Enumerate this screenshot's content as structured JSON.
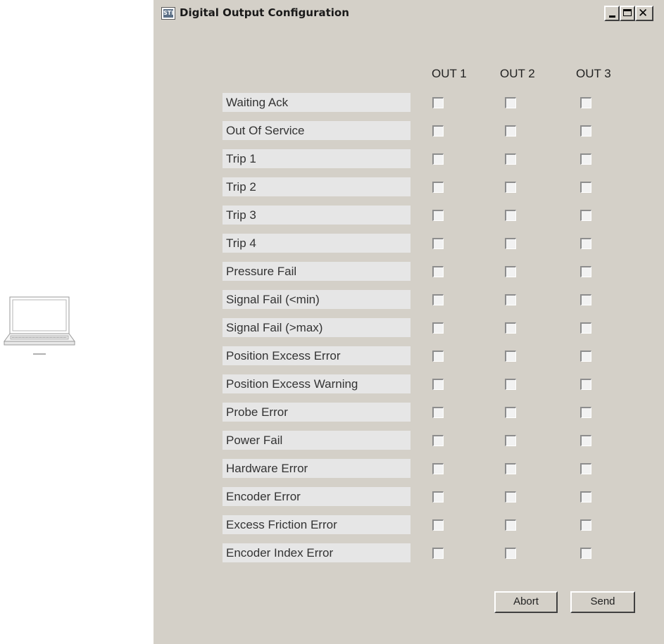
{
  "window": {
    "title": "Digital Output Configuration",
    "icon_text": "STI"
  },
  "columns": [
    "OUT 1",
    "OUT 2",
    "OUT 3"
  ],
  "rows": [
    {
      "label": "Waiting Ack",
      "checked": [
        false,
        false,
        false
      ]
    },
    {
      "label": "Out Of Service",
      "checked": [
        false,
        false,
        false
      ]
    },
    {
      "label": "Trip 1",
      "checked": [
        false,
        false,
        false
      ]
    },
    {
      "label": "Trip 2",
      "checked": [
        false,
        false,
        false
      ]
    },
    {
      "label": "Trip 3",
      "checked": [
        false,
        false,
        false
      ]
    },
    {
      "label": "Trip 4",
      "checked": [
        false,
        false,
        false
      ]
    },
    {
      "label": "Pressure Fail",
      "checked": [
        false,
        false,
        false
      ]
    },
    {
      "label": "Signal Fail (<min)",
      "checked": [
        false,
        false,
        false
      ]
    },
    {
      "label": "Signal Fail (>max)",
      "checked": [
        false,
        false,
        false
      ]
    },
    {
      "label": "Position Excess Error",
      "checked": [
        false,
        false,
        false
      ]
    },
    {
      "label": "Position Excess Warning",
      "checked": [
        false,
        false,
        false
      ]
    },
    {
      "label": "Probe Error",
      "checked": [
        false,
        false,
        false
      ]
    },
    {
      "label": "Power Fail",
      "checked": [
        false,
        false,
        false
      ]
    },
    {
      "label": "Hardware Error",
      "checked": [
        false,
        false,
        false
      ]
    },
    {
      "label": "Encoder Error",
      "checked": [
        false,
        false,
        false
      ]
    },
    {
      "label": "Excess Friction Error",
      "checked": [
        false,
        false,
        false
      ]
    },
    {
      "label": "Encoder Index Error",
      "checked": [
        false,
        false,
        false
      ]
    }
  ],
  "buttons": {
    "abort": "Abort",
    "send": "Send"
  },
  "icons": {
    "device": "laptop-icon",
    "minimize": "minimize-icon",
    "maximize": "maximize-icon",
    "close": "close-icon"
  }
}
